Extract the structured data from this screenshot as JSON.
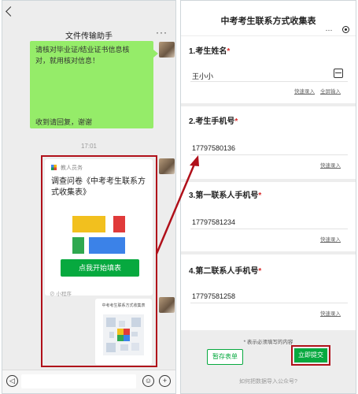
{
  "chat": {
    "title": "文件传输助手",
    "more": "···",
    "message_lines": [
      "请核对毕业证/结业证书信息核",
      "对，就用核对信息！",
      "收到请回复，谢谢"
    ],
    "timestamp": "17:01",
    "card": {
      "source": "教人员务",
      "title": "调查问卷《中考考生联系方式收集表》",
      "button": "点我开始填表",
      "footer": "小程序"
    },
    "card2": {
      "title": "中考考生联系方式收集表"
    },
    "input_icons": {
      "voice": "voice-icon",
      "emoji": "emoji-icon",
      "add": "add-icon"
    }
  },
  "form": {
    "title": "中考考生联系方式收集表",
    "more": "···",
    "questions": [
      {
        "label": "1.考生姓名",
        "required": "*",
        "value": "王小小",
        "links": [
          "快速录入",
          "全屏输入"
        ]
      },
      {
        "label": "2.考生手机号",
        "required": "*",
        "value": "17797580136",
        "links": [
          "快速录入"
        ]
      },
      {
        "label": "3.第一联系人手机号",
        "required": "*",
        "value": "17797581234",
        "links": [
          "快速录入"
        ]
      },
      {
        "label": "4.第二联系人手机号",
        "required": "*",
        "value": "17797581258",
        "links": [
          "快速录入"
        ]
      }
    ],
    "required_note": "* 表示必须填写的内容",
    "save_button": "暂存表单",
    "submit_button": "立即提交",
    "footer": "如何把数据导入公众号?"
  },
  "colors": {
    "chat_bubble": "#95ec69",
    "primary_green": "#07a93f",
    "highlight_red": "#b0101a",
    "required_red": "#d92b2b"
  }
}
